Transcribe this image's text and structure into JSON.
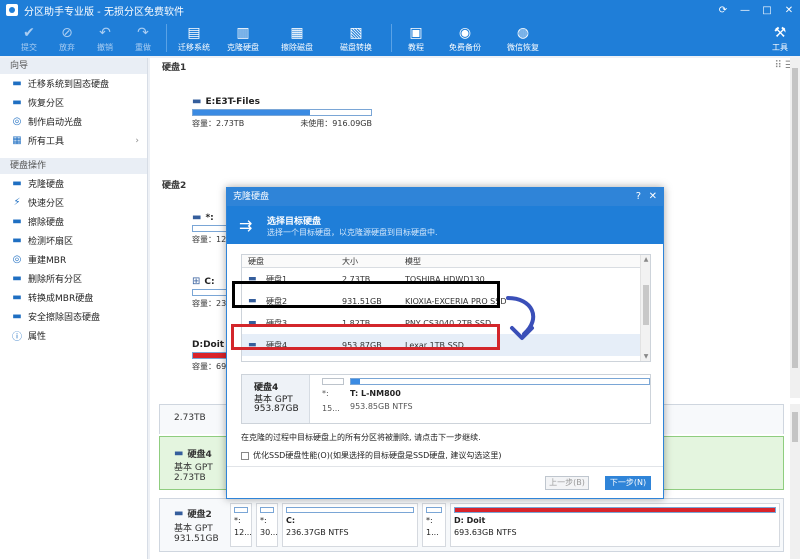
{
  "app": {
    "title": "分区助手专业版 - 无损分区免费软件",
    "window_controls": [
      "⟳",
      "—",
      "□",
      "✕"
    ]
  },
  "toolbar": {
    "items": [
      {
        "label": "提交",
        "icon": "check-icon",
        "glyph": "✔",
        "dim": true
      },
      {
        "label": "放弃",
        "icon": "cancel-icon",
        "glyph": "⊘",
        "dim": true
      },
      {
        "label": "撤销",
        "icon": "undo-icon",
        "glyph": "↶",
        "dim": true
      },
      {
        "label": "重做",
        "icon": "redo-icon",
        "glyph": "↷",
        "dim": true
      },
      {
        "label": "迁移系统",
        "icon": "migrate-icon",
        "glyph": "▤",
        "dim": false
      },
      {
        "label": "克隆硬盘",
        "icon": "clone-disk-icon",
        "glyph": "▥",
        "dim": false
      },
      {
        "label": "擦除磁盘",
        "icon": "wipe-disk-icon",
        "glyph": "▦",
        "dim": false
      },
      {
        "label": "磁盘转换",
        "icon": "convert-disk-icon",
        "glyph": "▧",
        "dim": false
      },
      {
        "label": "教程",
        "icon": "tutorial-icon",
        "glyph": "▣",
        "dim": false
      },
      {
        "label": "免费备份",
        "icon": "backup-icon",
        "glyph": "◉",
        "dim": false
      },
      {
        "label": "微信恢复",
        "icon": "wechat-recover-icon",
        "glyph": "◍",
        "dim": false
      }
    ],
    "tools_label": "工具"
  },
  "sidebar": {
    "wizard_title": "向导",
    "wizard_items": [
      {
        "label": "迁移系统到固态硬盘",
        "icon": "migrate-ssd-icon",
        "glyph": "▬"
      },
      {
        "label": "恢复分区",
        "icon": "restore-partition-icon",
        "glyph": "▬"
      },
      {
        "label": "制作启动光盘",
        "icon": "boot-disc-icon",
        "glyph": "◎"
      },
      {
        "label": "所有工具",
        "icon": "all-tools-icon",
        "glyph": "▦"
      }
    ],
    "disk_ops_title": "硬盘操作",
    "disk_ops_items": [
      {
        "label": "克隆硬盘",
        "icon": "clone-icon",
        "glyph": "▬"
      },
      {
        "label": "快速分区",
        "icon": "quick-partition-icon",
        "glyph": "⚡"
      },
      {
        "label": "擦除硬盘",
        "icon": "wipe-icon",
        "glyph": "▬"
      },
      {
        "label": "检测坏扇区",
        "icon": "bad-sector-icon",
        "glyph": "▬"
      },
      {
        "label": "重建MBR",
        "icon": "rebuild-mbr-icon",
        "glyph": "◎"
      },
      {
        "label": "删除所有分区",
        "icon": "delete-partitions-icon",
        "glyph": "▬"
      },
      {
        "label": "转换成MBR硬盘",
        "icon": "convert-mbr-icon",
        "glyph": "▬"
      },
      {
        "label": "安全擦除固态硬盘",
        "icon": "secure-erase-icon",
        "glyph": "▬"
      },
      {
        "label": "属性",
        "icon": "properties-icon",
        "glyph": "ⓘ"
      }
    ]
  },
  "main": {
    "disk1_header": "硬盘1",
    "disk2_header": "硬盘2",
    "disk1_partition": {
      "name": "E:E3T-Files",
      "capacity": "容量：2.73TB",
      "unused": "未使用：916.09GB",
      "fill_fraction": 0.66
    },
    "disk2_partitions": [
      {
        "name": "*:",
        "info": "容量：128",
        "fill_fraction": 0.0,
        "icon": "windows-drive-icon",
        "glyph": "▬"
      },
      {
        "name": "C:",
        "info": "容量：236",
        "fill_fraction": 0.0,
        "icon": "windows-drive-icon",
        "glyph": "⊞"
      },
      {
        "name": "D:Doit",
        "info": "容量：693",
        "fill_fraction": 1.0,
        "icon": "drive-icon",
        "glyph": ""
      }
    ],
    "bottom_disk1_size": "2.73TB",
    "bottom_disk4": {
      "name": "硬盘4",
      "type": "基本 GPT",
      "size": "2.73TB"
    },
    "bottom_disk2": {
      "name": "硬盘2",
      "type": "基本 GPT",
      "size": "931.51GB",
      "segments": [
        {
          "name": "*:",
          "info": "12..."
        },
        {
          "name": "*:",
          "info": "30..."
        },
        {
          "name": "C:",
          "info": "236.37GB NTFS"
        },
        {
          "name": "*:",
          "info": "1..."
        },
        {
          "name": "D: Doit",
          "info": "693.63GB NTFS"
        }
      ]
    }
  },
  "dialog": {
    "title": "克隆硬盘",
    "help": "?",
    "close": "✕",
    "heading": "选择目标硬盘",
    "subheading": "选择一个目标硬盘，以克隆源硬盘到目标硬盘中.",
    "columns": [
      "硬盘",
      "大小",
      "模型"
    ],
    "rows": [
      {
        "disk": "硬盘1",
        "size": "2.73TB",
        "model": "TOSHIBA HDWD130",
        "selected": false
      },
      {
        "disk": "硬盘2",
        "size": "931.51GB",
        "model": "KIOXIA-EXCERIA PRO SSD",
        "selected": false
      },
      {
        "disk": "硬盘3",
        "size": "1.82TB",
        "model": "PNY CS3040 2TB SSD",
        "selected": false
      },
      {
        "disk": "硬盘4",
        "size": "953.87GB",
        "model": "Lexar 1TB SSD",
        "selected": true
      }
    ],
    "preview": {
      "disk_name": "硬盘4",
      "disk_type": "基本 GPT",
      "disk_size": "953.87GB",
      "seg1_name": "*:",
      "seg1_info": "15...",
      "seg2_name": "T: L-NM800",
      "seg2_info": "953.85GB NTFS",
      "seg2_fill_fraction": 0.03
    },
    "note": "在克隆的过程中目标硬盘上的所有分区将被删除, 请点击下一步继续.",
    "checkbox_label": "优化SSD硬盘性能(O)(如果选择的目标硬盘是SSD硬盘, 建议勾选这里)",
    "back_button": "上一步(B)",
    "next_button": "下一步(N)"
  }
}
